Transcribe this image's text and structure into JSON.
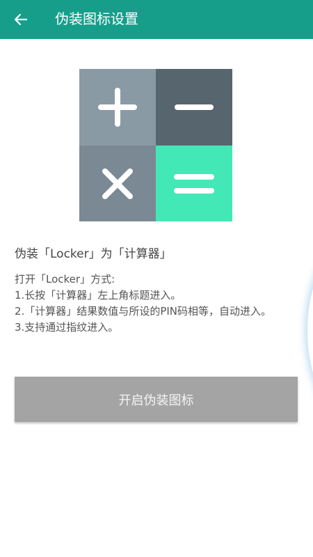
{
  "appbar": {
    "title": "伪装图标设置",
    "color": "#169e8b",
    "back_icon": "arrow-left-icon"
  },
  "art": {
    "tiles": [
      {
        "icon": "plus-icon",
        "color": "#8a9aa5"
      },
      {
        "icon": "minus-icon",
        "color": "#57656f"
      },
      {
        "icon": "multiply-icon",
        "color": "#7a8993"
      },
      {
        "icon": "equals-icon",
        "color": "#42e8b6"
      }
    ]
  },
  "content": {
    "heading": "伪装「Locker」为「计算器」",
    "intro": "打开「Locker」方式:",
    "steps": [
      "1.长按「计算器」左上角标题进入。",
      "2.「计算器」结果数值与所设的PIN码相等，自动进入。",
      "3.支持通过指纹进入。"
    ]
  },
  "action": {
    "enable_label": "开启伪装图标",
    "color": "#a4a4a4"
  }
}
